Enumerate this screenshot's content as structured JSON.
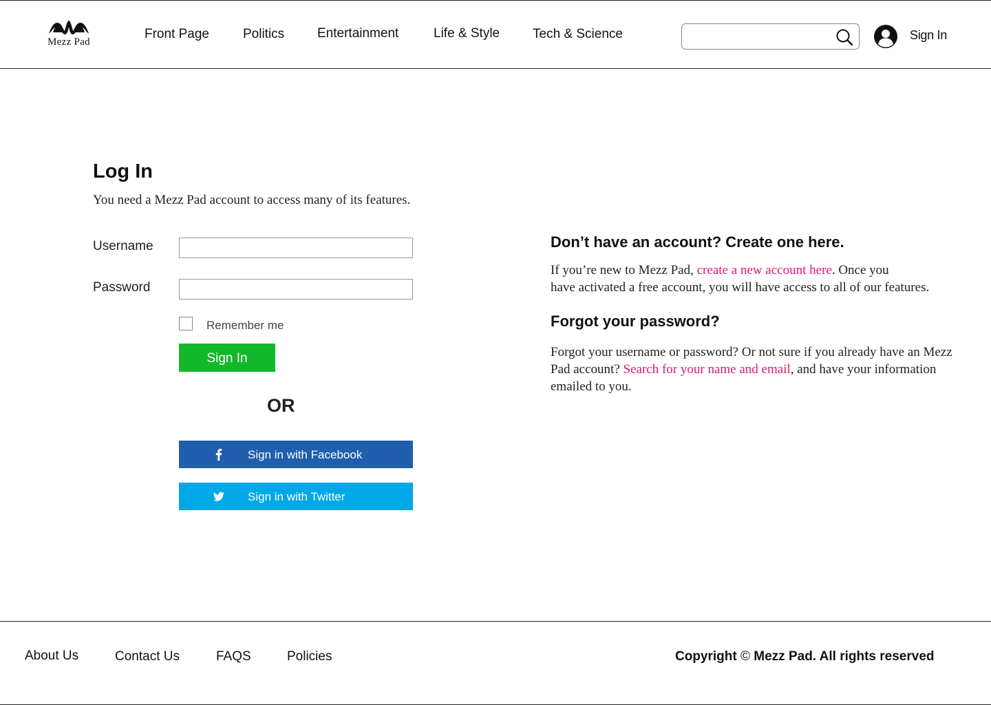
{
  "header": {
    "logo_text": "Mezz Pad",
    "nav": [
      "Front Page",
      "Politics",
      "Entertainment",
      "Life & Style",
      "Tech & Science"
    ],
    "search": {
      "value": "",
      "placeholder": ""
    },
    "signin_label": "Sign In"
  },
  "login": {
    "title": "Log In",
    "subtitle": "You need a Mezz Pad account to access many of its features.",
    "username_label": "Username",
    "username_value": "",
    "password_label": "Password",
    "password_value": "",
    "remember_label": "Remember me",
    "remember_checked": false,
    "signin_button": "Sign In",
    "or_text": "OR",
    "facebook_button": "Sign in with Facebook",
    "twitter_button": "Sign in with Twitter"
  },
  "create_account": {
    "heading": "Don’t have an account? Create one here.",
    "text_before": "If you’re new to Mezz Pad, ",
    "link": "create a new account here",
    "text_after_line1": ". Once you",
    "text_after_line2": "have activated a free account, you will have access to all of our features."
  },
  "forgot_password": {
    "heading": "Forgot your password?",
    "text_before": "Forgot your username or password? Or not sure if you already have an Mezz Pad account? ",
    "link": "Search for your name and email",
    "text_after": ", and have your information emailed to you."
  },
  "footer": {
    "links": [
      "About Us",
      "Contact Us",
      "FAQS",
      "Policies"
    ],
    "copyright_prefix": "Copyright",
    "copyright_symbol": "©",
    "copyright_suffix": "Mezz Pad. All rights reserved"
  },
  "colors": {
    "signin_green": "#12b82a",
    "facebook_blue": "#1f5fad",
    "twitter_blue": "#00a8e8",
    "link_pink": "#e0177a"
  }
}
